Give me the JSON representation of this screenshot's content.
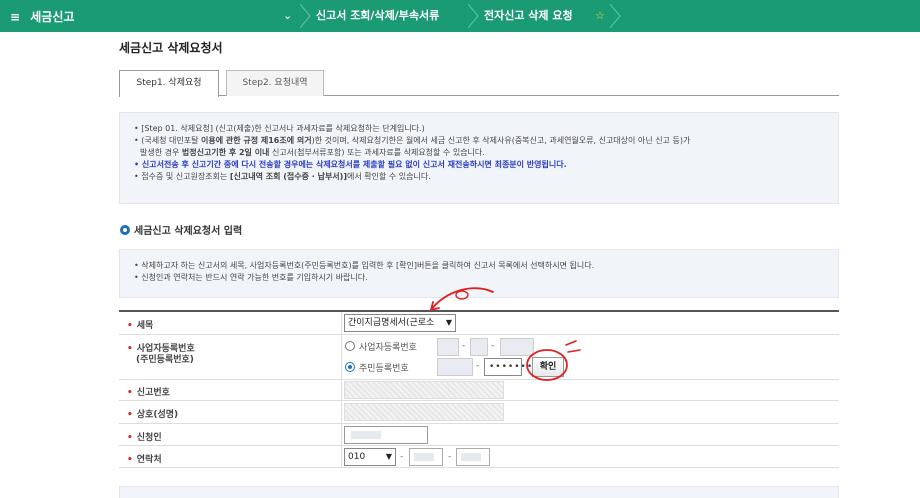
{
  "topbar": {
    "menu_icon": "≡",
    "menu_label": "세금신고",
    "dropdown_arrow": "⌄",
    "breadcrumb_1": "신고서 조회/삭제/부속서류",
    "breadcrumb_2": "전자신고 삭제 요청",
    "star_icon": "☆"
  },
  "page": {
    "title": "세금신고 삭제요청서"
  },
  "tabs": [
    {
      "label": "Step1. 삭제요청"
    },
    {
      "label": "Step2. 요청내역"
    }
  ],
  "info1": {
    "line1": "• [Step 01. 삭제요청] (신고(제출)한 신고서나 과세자료를 삭제요청하는 단계입니다.)",
    "line2a": "• (국세청 대민포탈 ",
    "line2b": "이용에 관한 규정 제16조에 의거",
    "line2c": ")한 것이며, 삭제요청기한은 월에서 세금 신고한 후 삭제사유(중복신고, 과세연월오류, 신고대상이 아닌 신고 등)가",
    "line3a": "발생한 경우 ",
    "line3b": "법정신고기한 후 2일 이내",
    "line3c": " 신고서(첨부서류포함) 또는 과세자료를 삭제요청할 수 있습니다.",
    "line4": "• 신고서전송 후 신고기간 중에 다시 전송할 경우에는 삭제요청서를 제출할 필요 없이 신고서 재전송하시면 최종분이 반영됩니다.",
    "line5a": "• 접수증 및 신고원장조회는 ",
    "line5b": "[신고내역 조회 (접수증 · 납부서)]",
    "line5c": "에서 확인할 수 있습니다."
  },
  "section": {
    "title": "세금신고 삭제요청서 입력"
  },
  "info2": {
    "line1": "• 삭제하고자 하는 신고서의 세목, 사업자등록번호(주민등록번호)를 입력한 후 [확인]버튼을 클릭하여 신고서 목록에서 선택하시면 됩니다.",
    "line2": "• 신청인과 연락처는 반드시 연락 가능한 번호를 기입하시기 바랍니다."
  },
  "form": {
    "star": "•",
    "tax_item_label": "세목",
    "tax_item_value": "간이지급명세서(근로소",
    "bizno_label_1": "사업자등록번호",
    "bizno_label_2": "(주민등록번호)",
    "radio_biz": "사업자등록번호",
    "radio_resident": "주민등록번호",
    "resident_masked": "•••••••",
    "confirm_button": "확인",
    "report_no_label": "신고번호",
    "company_label": "상호(성명)",
    "applicant_label": "신청인",
    "contact_label": "연락처",
    "phone_prefix": "010",
    "dash": "-"
  },
  "colors": {
    "topbar": "#1b9b73",
    "highlight_blue": "#2b3ec4",
    "annotation_red": "#e02020"
  }
}
